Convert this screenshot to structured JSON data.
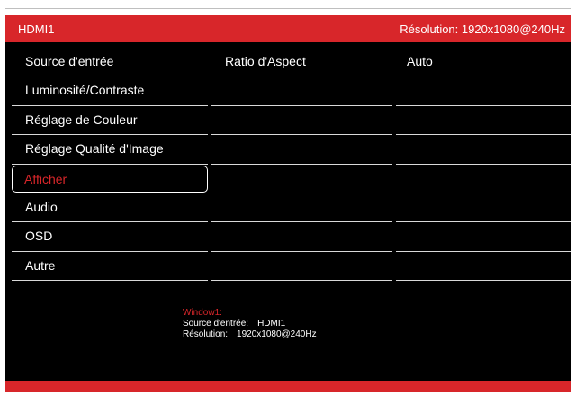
{
  "header": {
    "source": "HDMI1",
    "resolution": "Résolution: 1920x1080@240Hz"
  },
  "menu": {
    "items": [
      "Source d'entrée",
      "Luminosité/Contraste",
      "Réglage de Couleur",
      "Réglage Qualité d'Image",
      "Afficher",
      "Audio",
      "OSD",
      "Autre"
    ],
    "selected_index": 4
  },
  "submenu": {
    "items": [
      "Ratio d'Aspect",
      "",
      "",
      "",
      "",
      "",
      "",
      ""
    ]
  },
  "values": {
    "items": [
      "Auto",
      "",
      "",
      "",
      "",
      "",
      "",
      ""
    ]
  },
  "info": {
    "window_label": "Window1:",
    "source_key": "Source d'entrée:",
    "source_value": "HDMI1",
    "resolution_key": "Résolution:",
    "resolution_value": "1920x1080@240Hz"
  },
  "colors": {
    "accent": "#d8262a",
    "background": "#000000",
    "text": "#ffffff"
  }
}
